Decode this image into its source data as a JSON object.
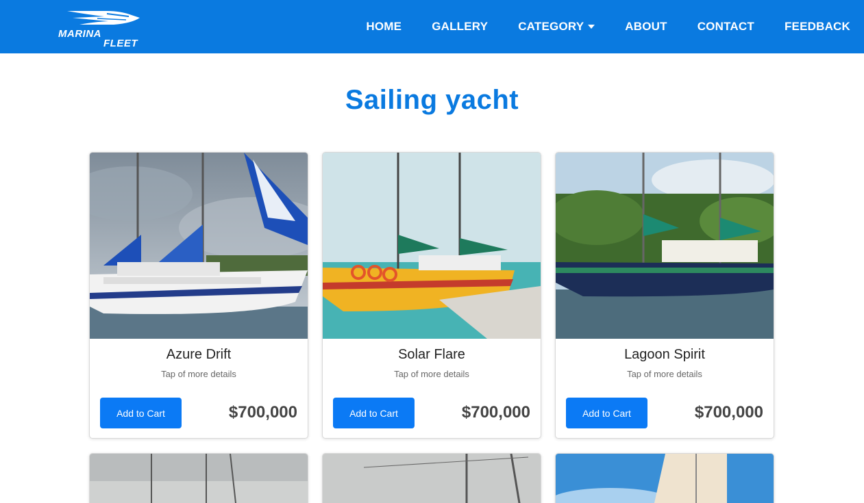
{
  "brand": {
    "line1": "MARINA",
    "line2": "FLEET"
  },
  "nav": {
    "items": [
      {
        "label": "HOME"
      },
      {
        "label": "GALLERY"
      },
      {
        "label": "CATEGORY"
      },
      {
        "label": "ABOUT"
      },
      {
        "label": "CONTACT"
      },
      {
        "label": "FEEDBACK"
      }
    ]
  },
  "page": {
    "title": "Sailing yacht"
  },
  "products": [
    {
      "name": "Azure Drift",
      "subtitle": "Tap of more details",
      "button": "Add to Cart",
      "price": "$700,000"
    },
    {
      "name": "Solar Flare",
      "subtitle": "Tap of more details",
      "button": "Add to Cart",
      "price": "$700,000"
    },
    {
      "name": "Lagoon Spirit",
      "subtitle": "Tap of more details",
      "button": "Add to Cart",
      "price": "$700,000"
    }
  ],
  "colors": {
    "brand": "#0a7ae0",
    "button": "#0b7af5",
    "price": "#444444"
  },
  "icons": {
    "logo": "boat-logo-icon",
    "dropdown": "caret-down-icon"
  }
}
